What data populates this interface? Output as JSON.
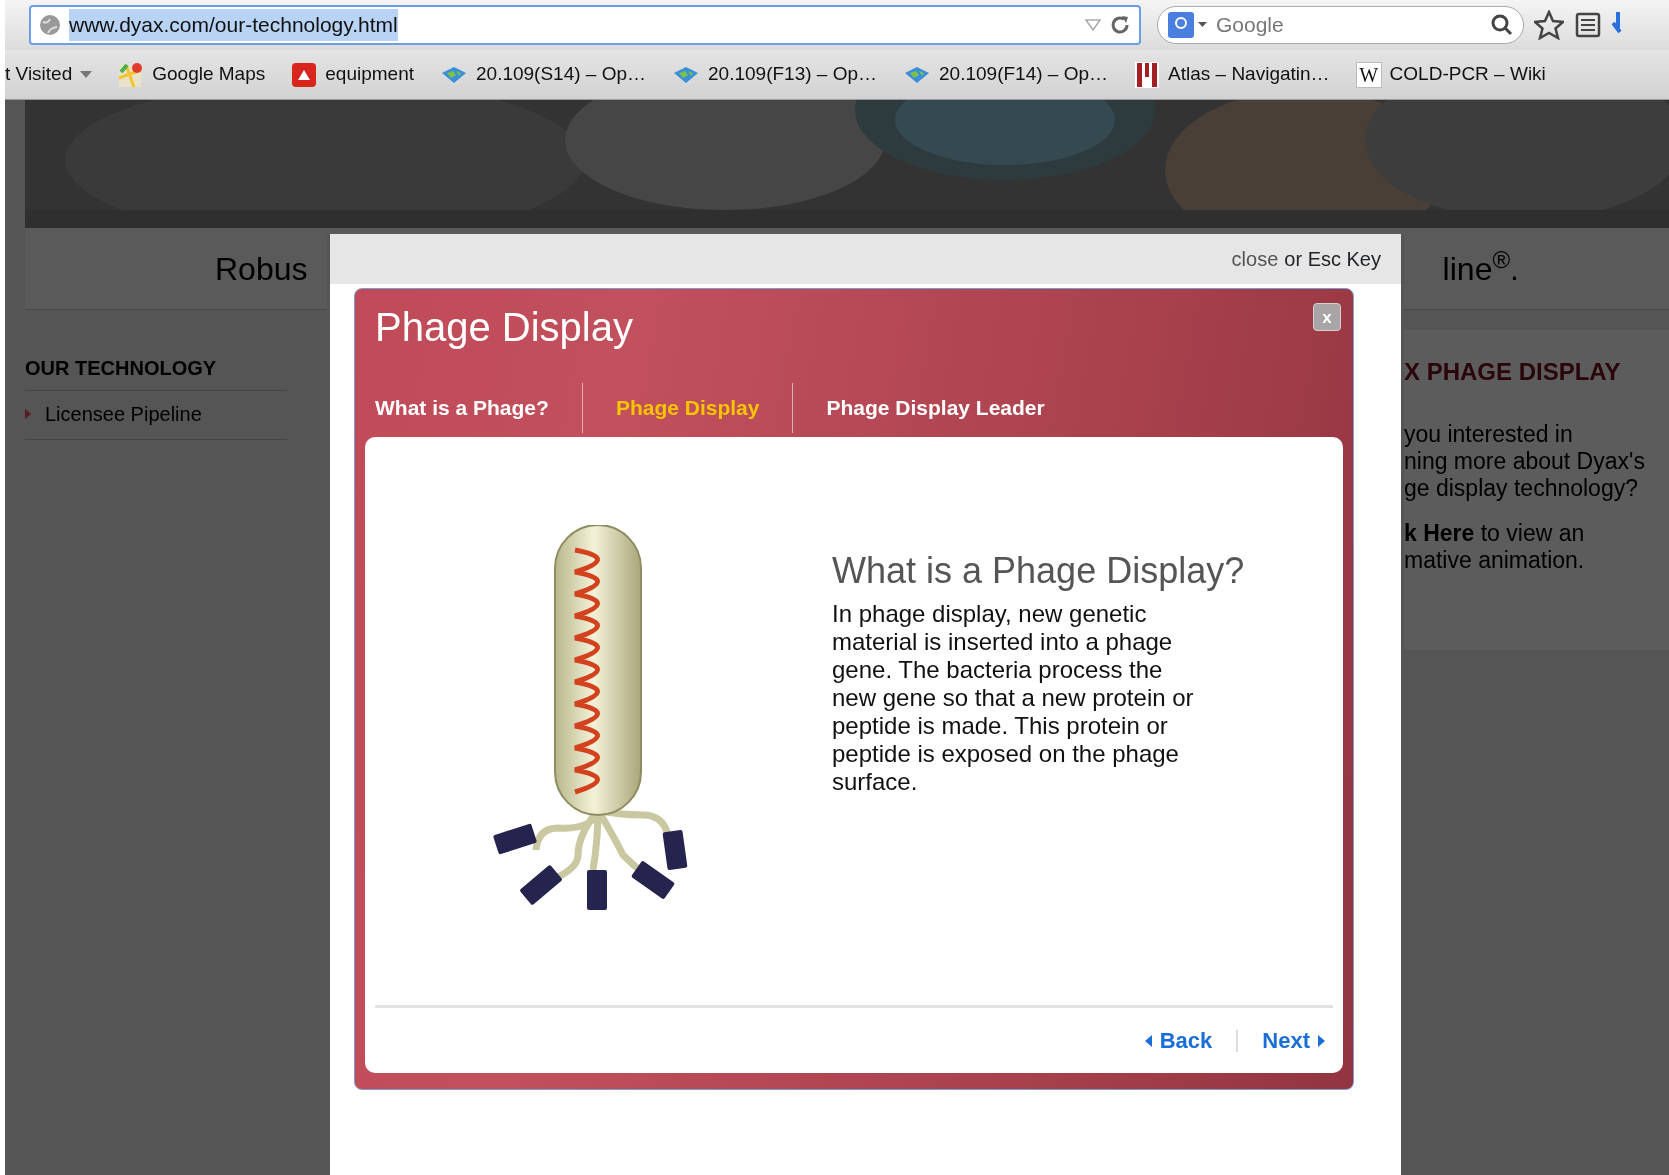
{
  "browser": {
    "url": "www.dyax.com/our-technology.html",
    "url_selected": true,
    "search_placeholder": "Google"
  },
  "bookmarks": [
    {
      "label": "t Visited",
      "kind": "folder"
    },
    {
      "label": "Google Maps",
      "kind": "maps"
    },
    {
      "label": "equipment",
      "kind": "app"
    },
    {
      "label": "20.109(S14) – Op…",
      "kind": "globe"
    },
    {
      "label": "20.109(F13) – Op…",
      "kind": "globe"
    },
    {
      "label": "20.109(F14) – Op…",
      "kind": "globe"
    },
    {
      "label": "Atlas – Navigatin…",
      "kind": "atlas"
    },
    {
      "label": "COLD-PCR – Wiki",
      "kind": "wiki",
      "glyph": "W"
    }
  ],
  "page": {
    "band_left": "Robus",
    "band_right": "line$^{®}$.",
    "sidebar_heading": "OUR TECHNOLOGY",
    "sidebar_items": [
      "Licensee Pipeline"
    ],
    "aside_heading": "X PHAGE DISPLAY",
    "aside_lines": [
      "you interested in",
      "ning more about Dyax's",
      "ge display technology?"
    ],
    "aside_link_lines": [
      "**k Here** to view an",
      "mative animation."
    ]
  },
  "lightbox": {
    "close_link": "close",
    "close_hint": "or Esc Key",
    "title": "Phage Display",
    "close_glyph": "x",
    "tabs": [
      {
        "label": "What is a Phage?",
        "selected": false
      },
      {
        "label": "Phage Display",
        "selected": true
      },
      {
        "label": "Phage Display Leader",
        "selected": false
      }
    ],
    "heading": "What is a Phage Display?",
    "body": "In phage display, new genetic material is inserted into a phage gene. The bacteria process the new gene so that a new protein or peptide is made. This protein or peptide is exposed on the phage surface.",
    "back": "Back",
    "next": "Next"
  }
}
